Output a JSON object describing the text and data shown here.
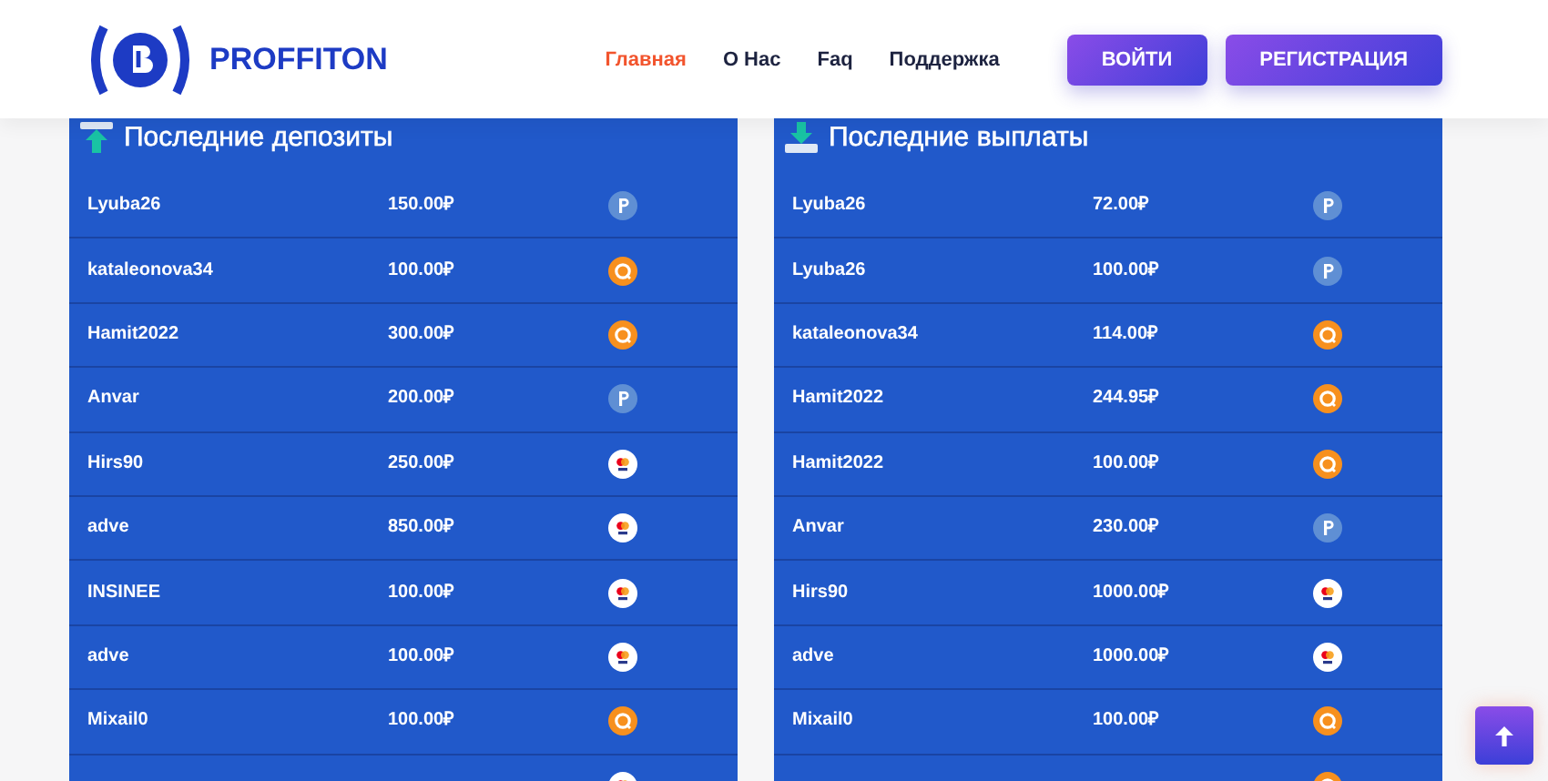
{
  "header": {
    "logo": "PROFFITON",
    "nav": [
      {
        "label": "Главная",
        "selected": true
      },
      {
        "label": "О Нас",
        "selected": false
      },
      {
        "label": "Faq",
        "selected": false
      },
      {
        "label": "Поддержка",
        "selected": false
      }
    ],
    "buttons": [
      "ВОЙТИ",
      "РЕГИСТРАЦИЯ"
    ]
  },
  "panels": [
    {
      "title": "Последние депозиты",
      "kind": "deposit",
      "rows": [
        {
          "name": "Lyuba26",
          "amount": "150.00₽",
          "kind": "payeer"
        },
        {
          "name": "kataleonova34",
          "amount": "100.00₽",
          "kind": "qiwi"
        },
        {
          "name": "Hamit2022",
          "amount": "300.00₽",
          "kind": "qiwi"
        },
        {
          "name": "Anvar",
          "amount": "200.00₽",
          "kind": "payeer"
        },
        {
          "name": "Hirs90",
          "amount": "250.00₽",
          "kind": "card"
        },
        {
          "name": "adve",
          "amount": "850.00₽",
          "kind": "card"
        },
        {
          "name": "INSINEE",
          "amount": "100.00₽",
          "kind": "card"
        },
        {
          "name": "adve",
          "amount": "100.00₽",
          "kind": "card"
        },
        {
          "name": "Mixail0",
          "amount": "100.00₽",
          "kind": "qiwi"
        },
        {
          "kind": "card"
        }
      ]
    },
    {
      "title": "Последние выплаты",
      "kind": "withdrawal",
      "rows": [
        {
          "name": "Lyuba26",
          "amount": "72.00₽",
          "kind": "payeer"
        },
        {
          "name": "Lyuba26",
          "amount": "100.00₽",
          "kind": "payeer"
        },
        {
          "name": "kataleonova34",
          "amount": "114.00₽",
          "kind": "qiwi"
        },
        {
          "name": "Hamit2022",
          "amount": "244.95₽",
          "kind": "qiwi"
        },
        {
          "name": "Hamit2022",
          "amount": "100.00₽",
          "kind": "qiwi"
        },
        {
          "name": "Anvar",
          "amount": "230.00₽",
          "kind": "payeer"
        },
        {
          "name": "Hirs90",
          "amount": "1000.00₽",
          "kind": "card"
        },
        {
          "name": "adve",
          "amount": "1000.00₽",
          "kind": "card"
        },
        {
          "name": "Mixail0",
          "amount": "100.00₽",
          "kind": "qiwi"
        },
        {
          "kind": "qiwi"
        }
      ]
    }
  ]
}
